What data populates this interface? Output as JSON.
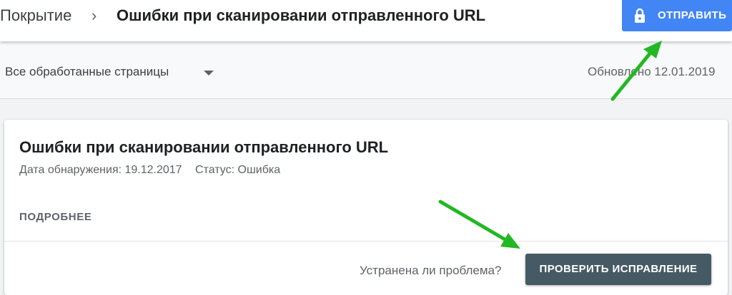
{
  "header": {
    "breadcrumb_root": "Покрытие",
    "breadcrumb_separator": "›",
    "breadcrumb_current": "Ошибки при сканировании отправленного URL",
    "submit_button_label": "ОТПРАВИТЬ",
    "submit_icon": "lock-icon"
  },
  "filter": {
    "selected_value": "Все обработанные страницы",
    "dropdown_icon": "caret-down-icon",
    "updated_text": "Обновлено 12.01.2019"
  },
  "issue_card": {
    "title": "Ошибки при сканировании отправленного URL",
    "detection_date": "Дата обнаружения: 19.12.2017",
    "status": "Статус: Ошибка",
    "details_link": "ПОДРОБНЕЕ",
    "question": "Устранена ли проблема?",
    "validate_button_label": "ПРОВЕРИТЬ ИСПРАВЛЕНИЕ"
  },
  "colors": {
    "primary_blue": "#4285f4",
    "validate_button": "#455a64",
    "annotation_arrow": "#22b822"
  }
}
